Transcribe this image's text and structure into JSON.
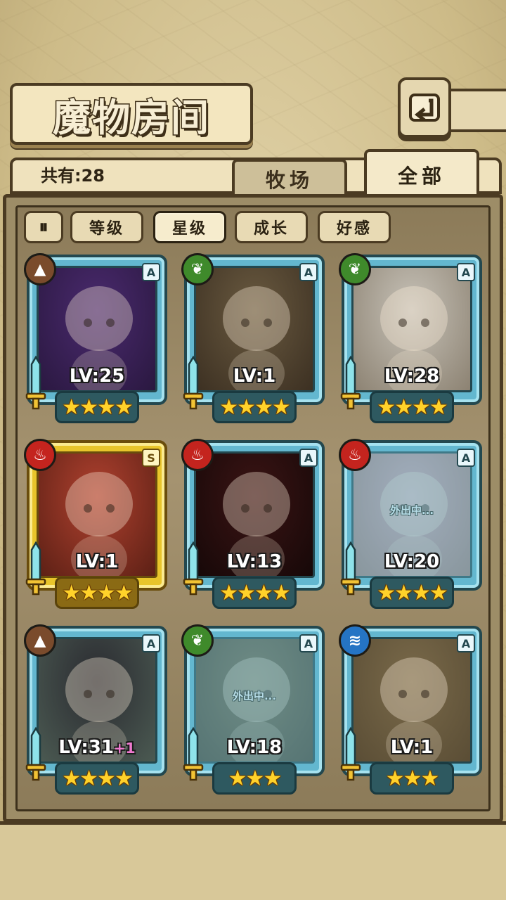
{
  "header": {
    "title": "魔物房间",
    "back_icon": "back-arrow-icon"
  },
  "tabs": {
    "count_label": "共有:28",
    "ranch": "牧场",
    "all": "全部",
    "selected": "全部"
  },
  "filters": {
    "toggle": "⏸",
    "items": [
      "等级",
      "星级",
      "成长",
      "好感"
    ],
    "selected": "星级"
  },
  "colors": {
    "earth": "#7a4b2c",
    "nature": "#3f8a2b",
    "fire": "#c4241e",
    "water": "#2574c4",
    "frame_blue": "#63b7cf",
    "frame_gold": "#e8c52b"
  },
  "cards": [
    {
      "element": "earth",
      "rank": "A",
      "level": "LV:25",
      "bonus": "",
      "stars": "★★★★",
      "status": ""
    },
    {
      "element": "nature",
      "rank": "A",
      "level": "LV:1",
      "bonus": "",
      "stars": "★★★★",
      "status": ""
    },
    {
      "element": "nature",
      "rank": "A",
      "level": "LV:28",
      "bonus": "",
      "stars": "★★★★",
      "status": ""
    },
    {
      "element": "fire",
      "rank": "S",
      "level": "LV:1",
      "bonus": "",
      "stars": "★★★★",
      "status": ""
    },
    {
      "element": "fire",
      "rank": "A",
      "level": "LV:13",
      "bonus": "",
      "stars": "★★★★",
      "status": ""
    },
    {
      "element": "fire",
      "rank": "A",
      "level": "LV:20",
      "bonus": "",
      "stars": "★★★★",
      "status": "外出中..."
    },
    {
      "element": "earth",
      "rank": "A",
      "level": "LV:31",
      "bonus": "+1",
      "stars": "★★★★",
      "status": ""
    },
    {
      "element": "nature",
      "rank": "A",
      "level": "LV:18",
      "bonus": "",
      "stars": "★★★",
      "status": "外出中..."
    },
    {
      "element": "water",
      "rank": "A",
      "level": "LV:1",
      "bonus": "",
      "stars": "★★★",
      "status": ""
    }
  ]
}
